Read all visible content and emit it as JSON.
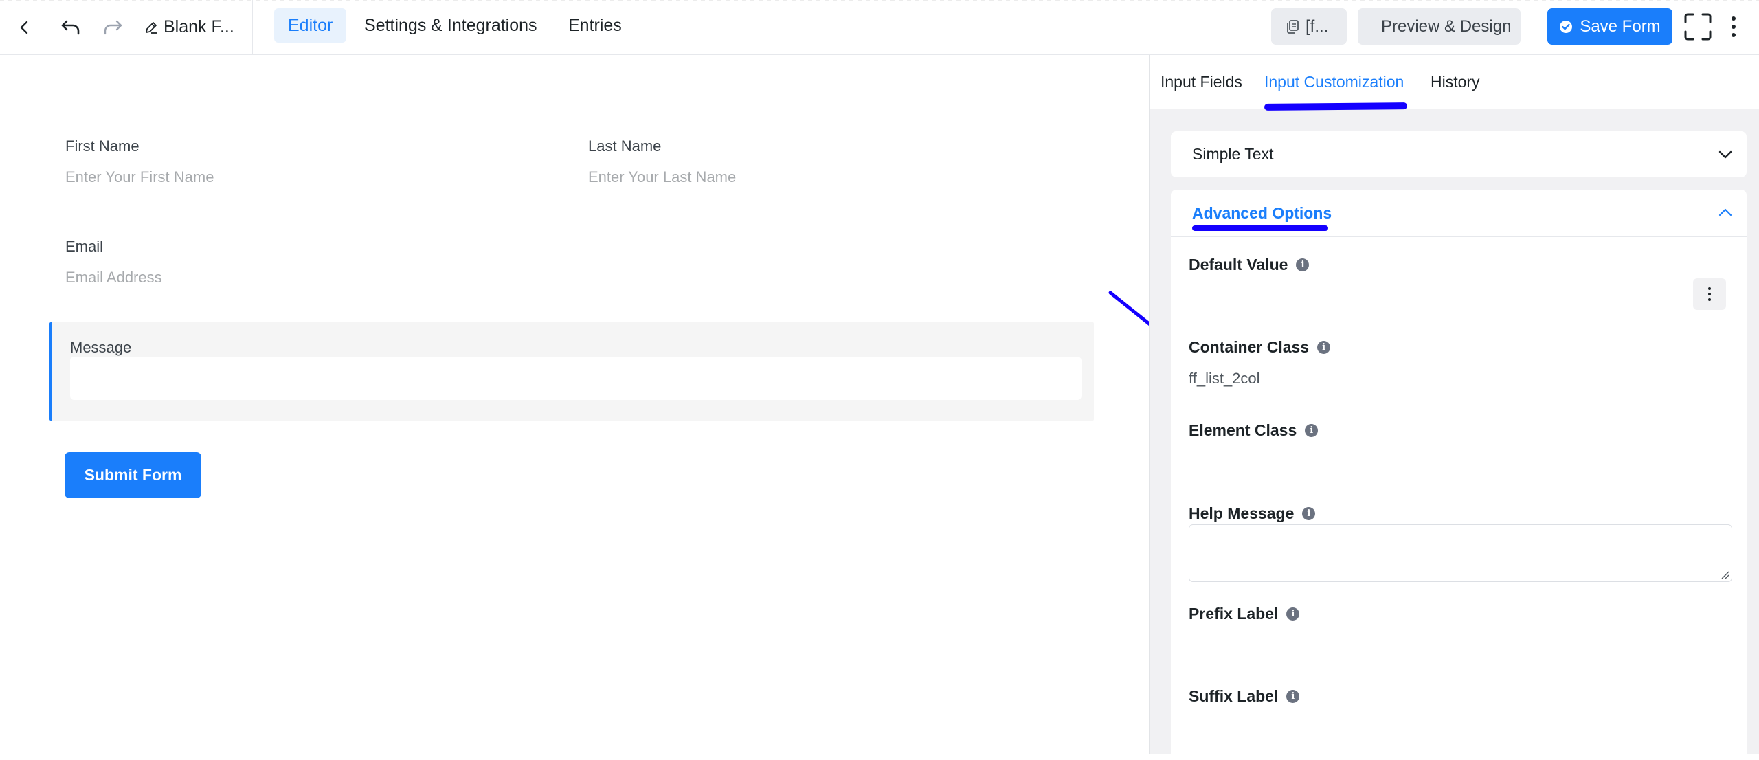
{
  "topbar": {
    "form_title": "Blank F...",
    "tabs": [
      {
        "label": "Editor",
        "active": true
      },
      {
        "label": "Settings & Integrations",
        "active": false
      },
      {
        "label": "Entries",
        "active": false
      }
    ],
    "shortcode_label": "[f...",
    "preview_label": "Preview & Design",
    "save_label": "Save Form"
  },
  "form": {
    "first_name": {
      "label": "First Name",
      "placeholder": "Enter Your First Name"
    },
    "last_name": {
      "label": "Last Name",
      "placeholder": "Enter Your Last Name"
    },
    "email": {
      "label": "Email",
      "placeholder": "Email Address"
    },
    "message": {
      "label": "Message",
      "value": ""
    },
    "submit_label": "Submit Form"
  },
  "panel": {
    "tabs": [
      {
        "label": "Input Fields",
        "active": false
      },
      {
        "label": "Input Customization",
        "active": true
      },
      {
        "label": "History",
        "active": false
      }
    ],
    "simple_text_label": "Simple Text",
    "advanced_title": "Advanced Options",
    "fields": {
      "default_value": "Default Value",
      "container_class": "Container Class",
      "container_class_value": "ff_list_2col",
      "element_class": "Element Class",
      "help_message": "Help Message",
      "prefix_label": "Prefix Label",
      "suffix_label": "Suffix Label"
    },
    "info_glyph": "i"
  },
  "colors": {
    "accent": "#1a7efb",
    "annotation": "#1400ff",
    "panel_bg": "#f1f1f3"
  },
  "icons": [
    "chevron-left-icon",
    "undo-icon",
    "redo-icon",
    "pencil-icon",
    "shortcode-icon",
    "eye-icon",
    "check-circle-icon",
    "fullscreen-icon",
    "kebab-icon",
    "chevron-down-icon",
    "chevron-up-icon",
    "info-icon",
    "annotation-arrow"
  ]
}
